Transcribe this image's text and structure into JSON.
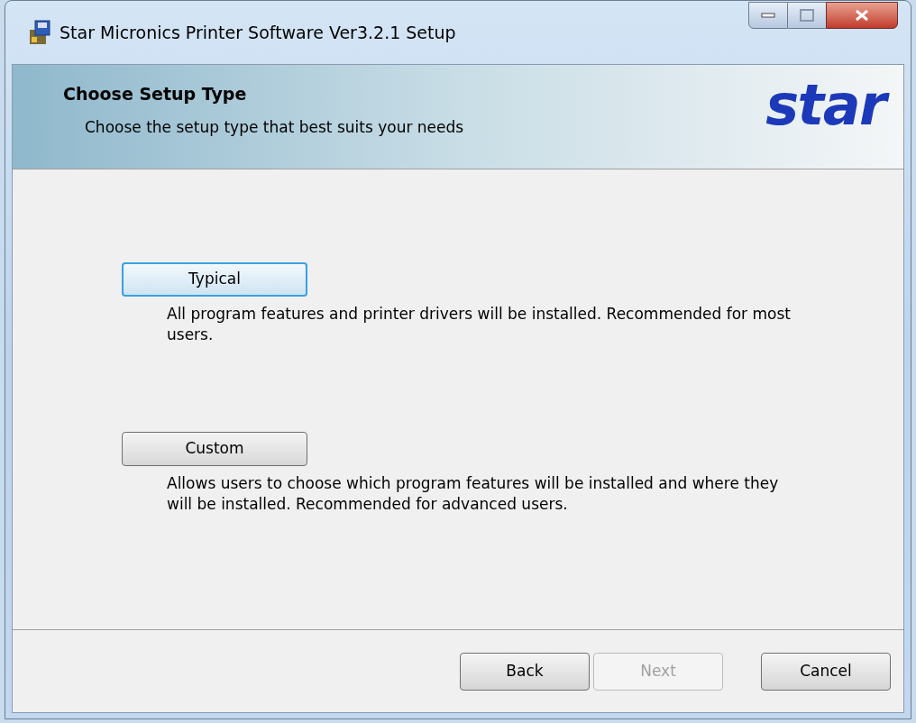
{
  "window": {
    "title": "Star Micronics Printer Software Ver3.2.1 Setup"
  },
  "header": {
    "title": "Choose Setup Type",
    "subtitle": "Choose the setup type that best suits your needs",
    "logo": "star"
  },
  "options": [
    {
      "label": "Typical",
      "focused": true,
      "description": "All program features and printer drivers will be installed. Recommended for most users."
    },
    {
      "label": "Custom",
      "focused": false,
      "description": "Allows users to choose which program features will be installed and where they will be installed. Recommended for advanced users."
    }
  ],
  "buttons": [
    {
      "label": "Back",
      "disabled": false
    },
    {
      "label": "Next",
      "disabled": true
    },
    {
      "label": "Cancel",
      "disabled": false
    }
  ]
}
